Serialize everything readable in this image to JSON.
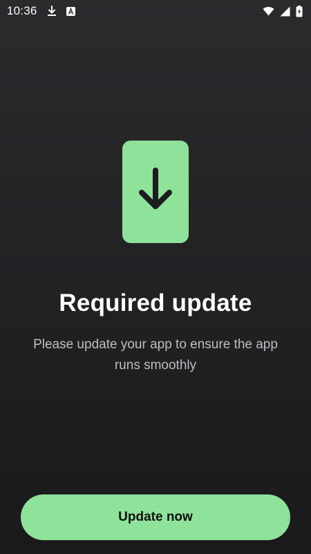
{
  "status_bar": {
    "time": "10:36",
    "icons": [
      "download-icon",
      "a-badge-icon",
      "wifi-icon",
      "signal-icon",
      "battery-charging-icon"
    ]
  },
  "hero": {
    "icon": "download-arrow-icon"
  },
  "content": {
    "title": "Required update",
    "subtitle": "Please update your app to ensure the app runs smoothly"
  },
  "actions": {
    "update_label": "Update now"
  },
  "colors": {
    "accent": "#8ee29a",
    "background": "#232326",
    "subtitle_text": "#bdbdc2"
  }
}
